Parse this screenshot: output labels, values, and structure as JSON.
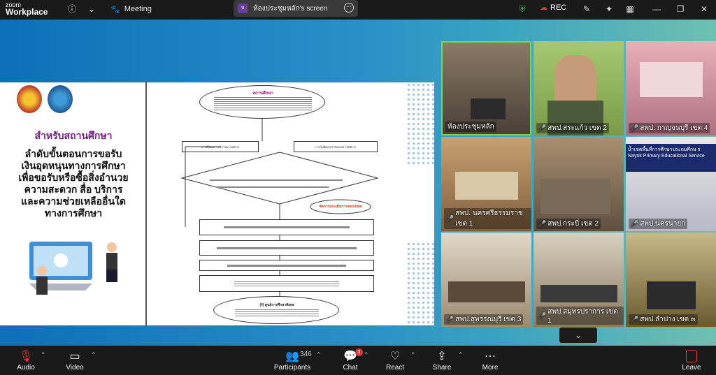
{
  "titlebar": {
    "logo_top": "zoom",
    "logo_bottom": "Workplace",
    "meeting_label": "Meeting",
    "screen_share_label": "ห้องประชุมหลัก's screen",
    "screen_avatar": "ห",
    "rec_label": "REC"
  },
  "slide": {
    "heading_sub": "สำหรับสถานศึกษา",
    "heading_main": [
      "ลำดับขั้นตอนการขอรับ",
      "เงินอุดหนุนทางการศึกษา",
      "เพื่อขอรับหรือซื้อสิ่งอำนวย",
      "ความสะดวก สื่อ บริการ",
      "และความช่วยเหลืออื่นใด",
      "ทางการศึกษา"
    ],
    "flow_top_title": "สถานศึกษา",
    "flow_box_left": "การมีข้อมสารบริการความพิการ",
    "flow_box_right": "การไม่มีเอกสารรับรองความพิการ",
    "flow_red_label": "จัดการประเมินการสอบเบทส",
    "flow_bottom_title": "(4) ศูนย์การศึกษาพิเศษ"
  },
  "participants": [
    {
      "name": "ห้องประชุมหลัก",
      "muted": false
    },
    {
      "name": "สพป.สระแก้ว เขต 2",
      "muted": true
    },
    {
      "name": "สพป. กาญจนบุรี เขต 4",
      "muted": true
    },
    {
      "name": "สพป. นครศรีธรรมราช เขต 1",
      "muted": true
    },
    {
      "name": "สพป.กระบี่ เขต 2",
      "muted": true
    },
    {
      "name": "สพป.นครนายก",
      "muted": true
    },
    {
      "name": "สพป.สุพรรณบุรี เขต 3",
      "muted": true
    },
    {
      "name": "สพป.สมุทรปราการ เขต 1",
      "muted": true
    },
    {
      "name": "สพป.ลำปาง เขต ๓",
      "muted": true
    }
  ],
  "tile_overlay_text": "น้ำเขตพื้นที่การศึกษาประถมศึกษ n Nayok Primary Educational Service",
  "toolbar": {
    "audio_label": "Audio",
    "video_label": "Video",
    "participants_label": "Participants",
    "participants_count": "346",
    "chat_label": "Chat",
    "chat_badge": "3",
    "react_label": "React",
    "share_label": "Share",
    "more_label": "More",
    "leave_label": "Leave"
  },
  "colors": {
    "active_speaker": "#7fd34f",
    "leave": "#e5333a",
    "slide_heading": "#7a1a8a"
  }
}
